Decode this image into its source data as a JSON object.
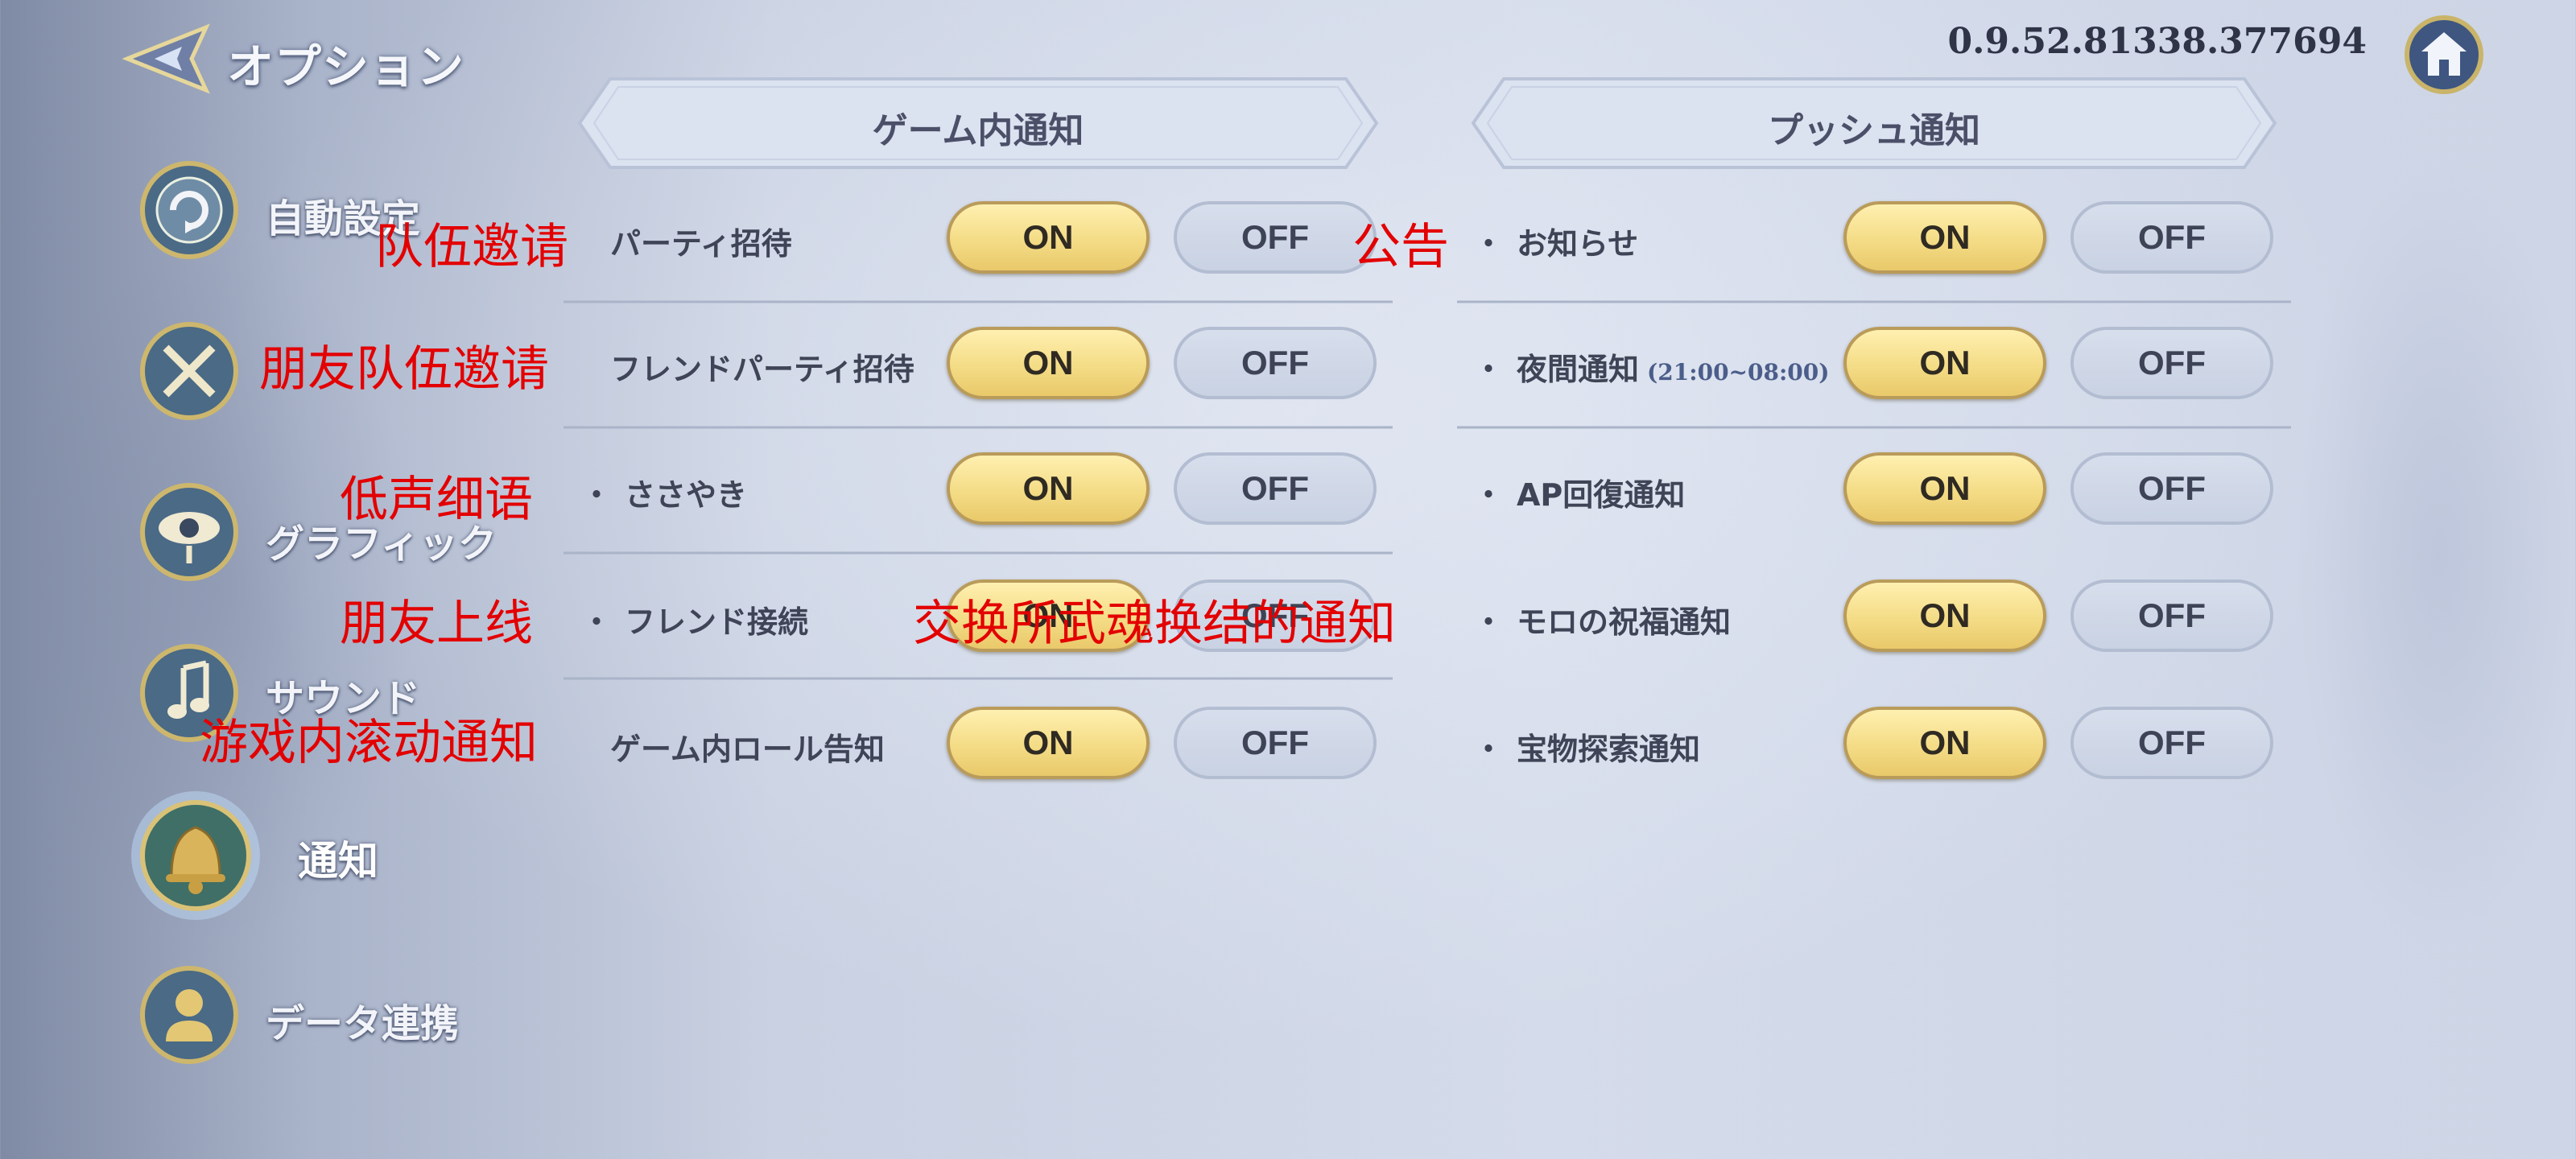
{
  "header": {
    "title": "オプション",
    "version": "0.9.52.81338.377694"
  },
  "sidebar": {
    "items": [
      {
        "label": "自動設定",
        "icon": "auto-setting-icon"
      },
      {
        "label": "",
        "icon": "swords-icon"
      },
      {
        "label": "グラフィック",
        "icon": "eye-icon"
      },
      {
        "label": "サウンド",
        "icon": "music-note-icon"
      },
      {
        "label": "通知",
        "icon": "bell-icon",
        "active": true
      },
      {
        "label": "データ連携",
        "icon": "person-icon"
      }
    ]
  },
  "sections": {
    "in_game": {
      "title": "ゲーム内通知",
      "rows": [
        {
          "label": "パーティ招待"
        },
        {
          "label": "フレンドパーティ招待"
        },
        {
          "label": "ささやき"
        },
        {
          "label": "フレンド接続"
        },
        {
          "label": "ゲーム内ロール告知"
        }
      ]
    },
    "push": {
      "title": "プッシュ通知",
      "rows": [
        {
          "label": "お知らせ"
        },
        {
          "label": "夜間通知",
          "sub": "(21:00~08:00)"
        },
        {
          "label": "AP回復通知"
        },
        {
          "label": "モロの祝福通知"
        },
        {
          "label": "宝物探索通知"
        }
      ]
    }
  },
  "buttons": {
    "on": "ON",
    "off": "OFF",
    "bullet": "・"
  },
  "annotations": [
    "队伍邀请",
    "朋友队伍邀请",
    "低声细语",
    "朋友上线",
    "游戏内滚动通知",
    "公告",
    "交换所武魂换结的通知"
  ],
  "colors": {
    "on_fill": "#f4dc86",
    "off_fill": "#c9d2e3",
    "annotation": "#e30000"
  }
}
